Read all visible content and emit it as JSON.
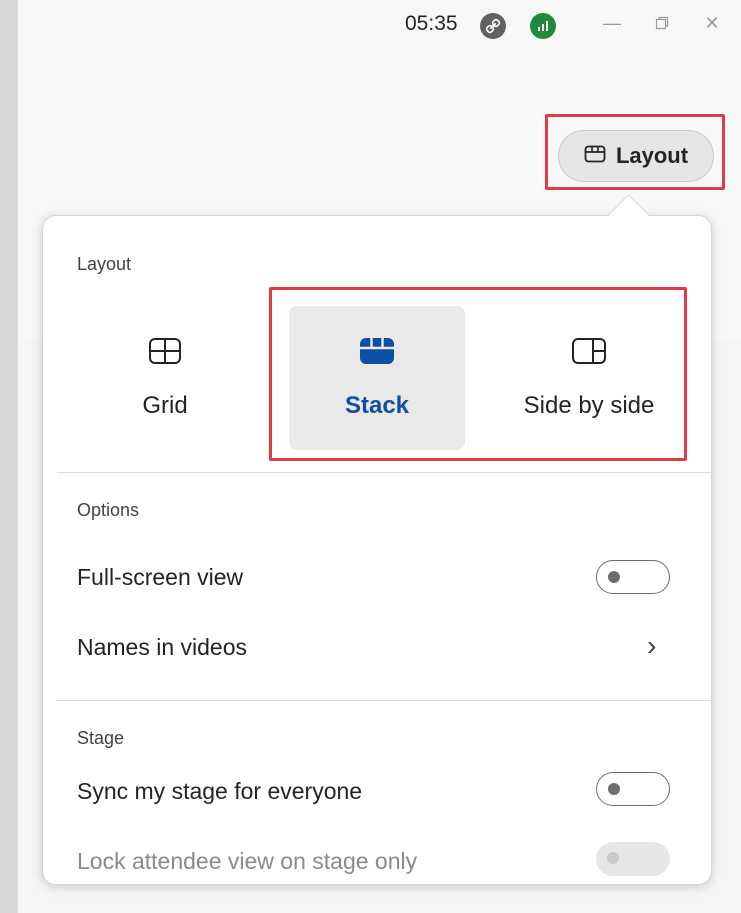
{
  "titlebar": {
    "time": "05:35"
  },
  "layout_button": {
    "label": "Layout"
  },
  "popup": {
    "layout_section": {
      "title": "Layout",
      "options": [
        {
          "label": "Grid",
          "icon": "grid-icon",
          "selected": false
        },
        {
          "label": "Stack",
          "icon": "stack-icon",
          "selected": true
        },
        {
          "label": "Side by side",
          "icon": "side-by-side-icon",
          "selected": false
        }
      ]
    },
    "options_section": {
      "title": "Options",
      "full_screen_label": "Full-screen view",
      "full_screen_on": false,
      "names_in_videos_label": "Names in videos"
    },
    "stage_section": {
      "title": "Stage",
      "sync_label": "Sync my stage for everyone",
      "sync_on": false,
      "lock_label": "Lock attendee view on stage only",
      "lock_on": false,
      "lock_disabled": true
    }
  },
  "colors": {
    "accent": "#0f4ea6",
    "highlight": "#e23b46",
    "signal": "#1f8a3a"
  }
}
